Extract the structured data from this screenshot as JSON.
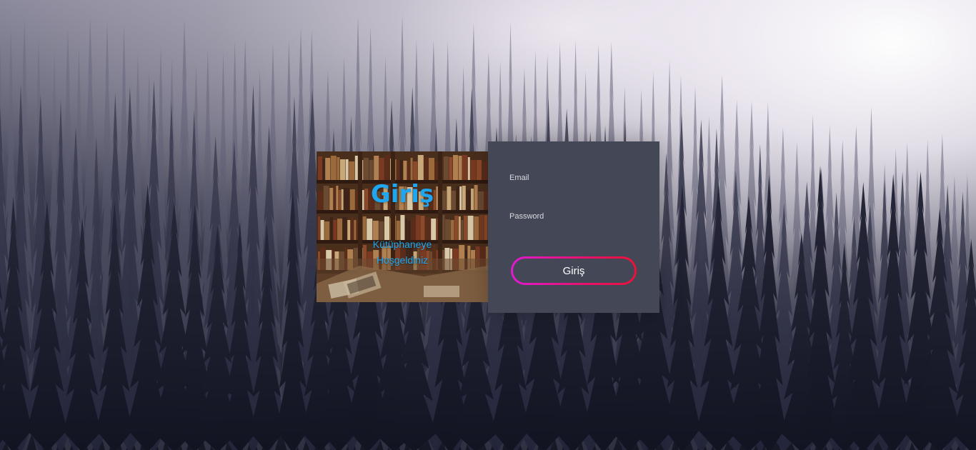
{
  "welcome_panel": {
    "title": "Giriş",
    "subtitle_line1": "Kütüphaneye",
    "subtitle_line2": "Hoşgeldiniz"
  },
  "login_form": {
    "email_label": "Email",
    "email_value": "",
    "password_label": "Password",
    "password_value": "",
    "submit_label": "Giriş"
  },
  "colors": {
    "accent_blue": "#1ea7f0",
    "form_background": "#444755",
    "button_gradient_start": "#e01ad2",
    "button_gradient_end": "#ea1238"
  }
}
